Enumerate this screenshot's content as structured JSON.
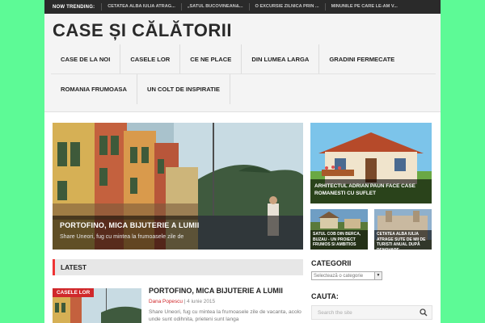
{
  "trending": {
    "label": "NOW TRENDING:",
    "items": [
      "CETATEA ALBA IULIA ATRAG...",
      "„SATUL BUCOVINEAN&...",
      "O EXCURSIE ZILNICA PRIN ...",
      "MINUNILE PE CARE LE-AM V..."
    ]
  },
  "site": {
    "title": "CASE ȘI CĂLĂTORII"
  },
  "nav": {
    "row1": [
      "CASE DE LA NOI",
      "CASELE LOR",
      "CE NE PLACE",
      "DIN LUMEA LARGA",
      "GRADINI FERMECATE"
    ],
    "row2": [
      "ROMANIA FRUMOASA",
      "UN COLT DE INSPIRATIE"
    ]
  },
  "featured": {
    "main": {
      "title": "PORTOFINO, MICA BIJUTERIE A LUMII",
      "excerpt": "Share Uneori, fug cu mintea la frumoasele zile de"
    },
    "side": {
      "title": "ARHITECTUL ADRIAN PAUN FACE CASE ROMANESTI CU SUFLET"
    },
    "small": [
      {
        "title": "SATUL COB DIN BERCA, BUZAU - UN PROIECT FRUMOS SI AMBITIOS"
      },
      {
        "title": "CETATEA ALBA IULIA ATRAGE SUTE DE MII DE TURISTI ANUAL DUPĂ RENOVARE"
      }
    ]
  },
  "latest": {
    "heading": "LATEST",
    "post": {
      "category": "CASELE LOR",
      "title": "PORTOFINO, MICA BIJUTERIE A LUMII",
      "author": "Dana Popescu",
      "separator": "|",
      "date": "4 iunie 2015",
      "excerpt": "Share Uneori, fug cu mintea la frumoasele zile de vacanta, acolo unde sunt odihnita, prieteni sunt langa"
    }
  },
  "sidebar": {
    "categories_title": "CATEGORII",
    "categories_select": "Selectează o categorie",
    "search_title": "CAUTA:",
    "search_placeholder": "Search the site"
  },
  "colors": {
    "background": "#5dfa96",
    "accent": "#d0282b",
    "topbar": "#2a2a2a"
  }
}
